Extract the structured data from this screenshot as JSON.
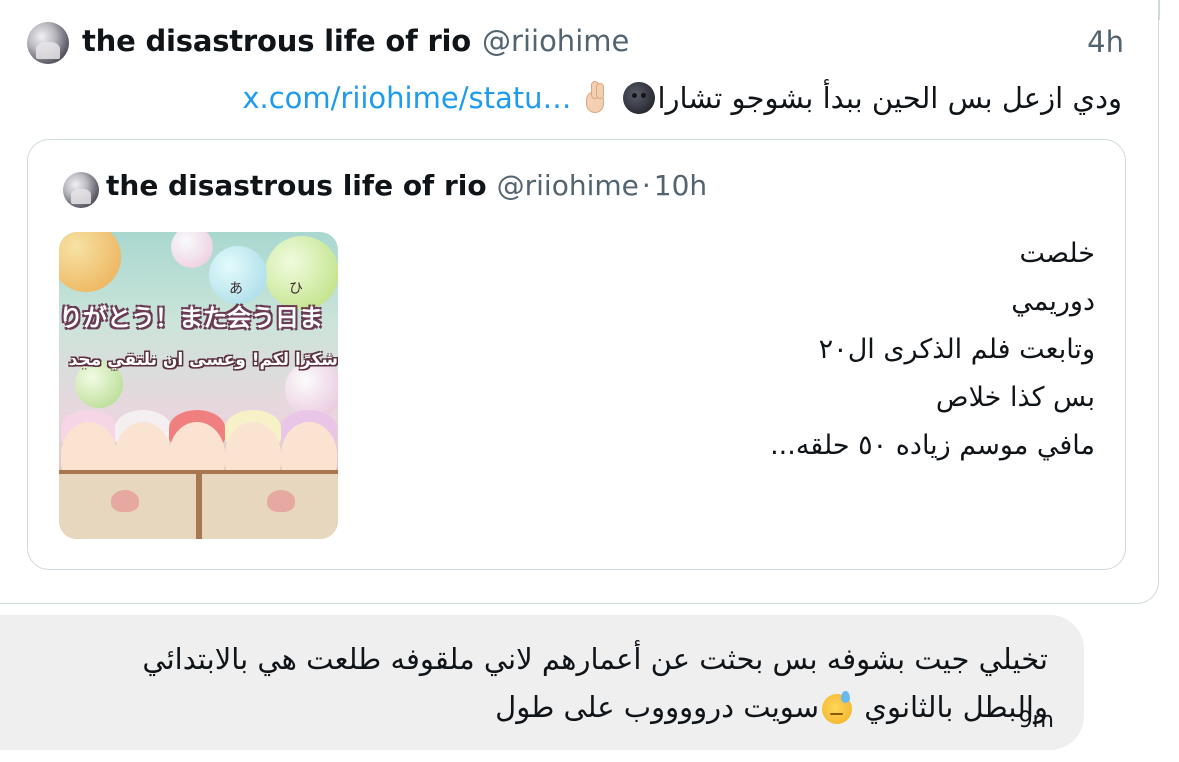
{
  "tweet": {
    "author": {
      "display_name": "the disastrous life of rio",
      "handle": "@riiohime"
    },
    "timestamp": "4h",
    "text": "ودي ازعل بس الحين ببدأ بشوجو تشارا",
    "emojis": [
      "new-moon-face-emoji",
      "crossed-fingers-emoji"
    ],
    "link": "x.com/riiohime/statu…",
    "quote": {
      "author": {
        "display_name": "the disastrous life of rio",
        "handle": "@riiohime"
      },
      "separator": "·",
      "timestamp": "10h",
      "media": {
        "japanese_caption": "りがとう！また会う日ま",
        "furigana_a": "あ",
        "furigana_hi": "ひ",
        "arabic_caption": "شكرًا لكم! وعسى ان نلتقي مجد"
      },
      "lines": [
        "خلصت",
        "دوريمي",
        "وتابعت فلم الذكرى ال٢٠",
        "بس كذا خلاص",
        "مافي موسم زياده ٥٠ حلقه..."
      ]
    }
  },
  "reply": {
    "line1": "تخيلي جيت بشوفه بس بحثت عن أعمارهم لاني ملقوفه طلعت هي بالابتدائي",
    "line2_start": "والبطل بالثانوي",
    "line2_end": "سويت درووووب على طول",
    "emoji": "downcast-sweat-face-emoji",
    "timestamp": "9m"
  },
  "colors": {
    "text": "#0f1419",
    "secondary": "#536471",
    "link": "#1d9bf0",
    "border": "#cfd9de",
    "bubble": "#efefef"
  }
}
